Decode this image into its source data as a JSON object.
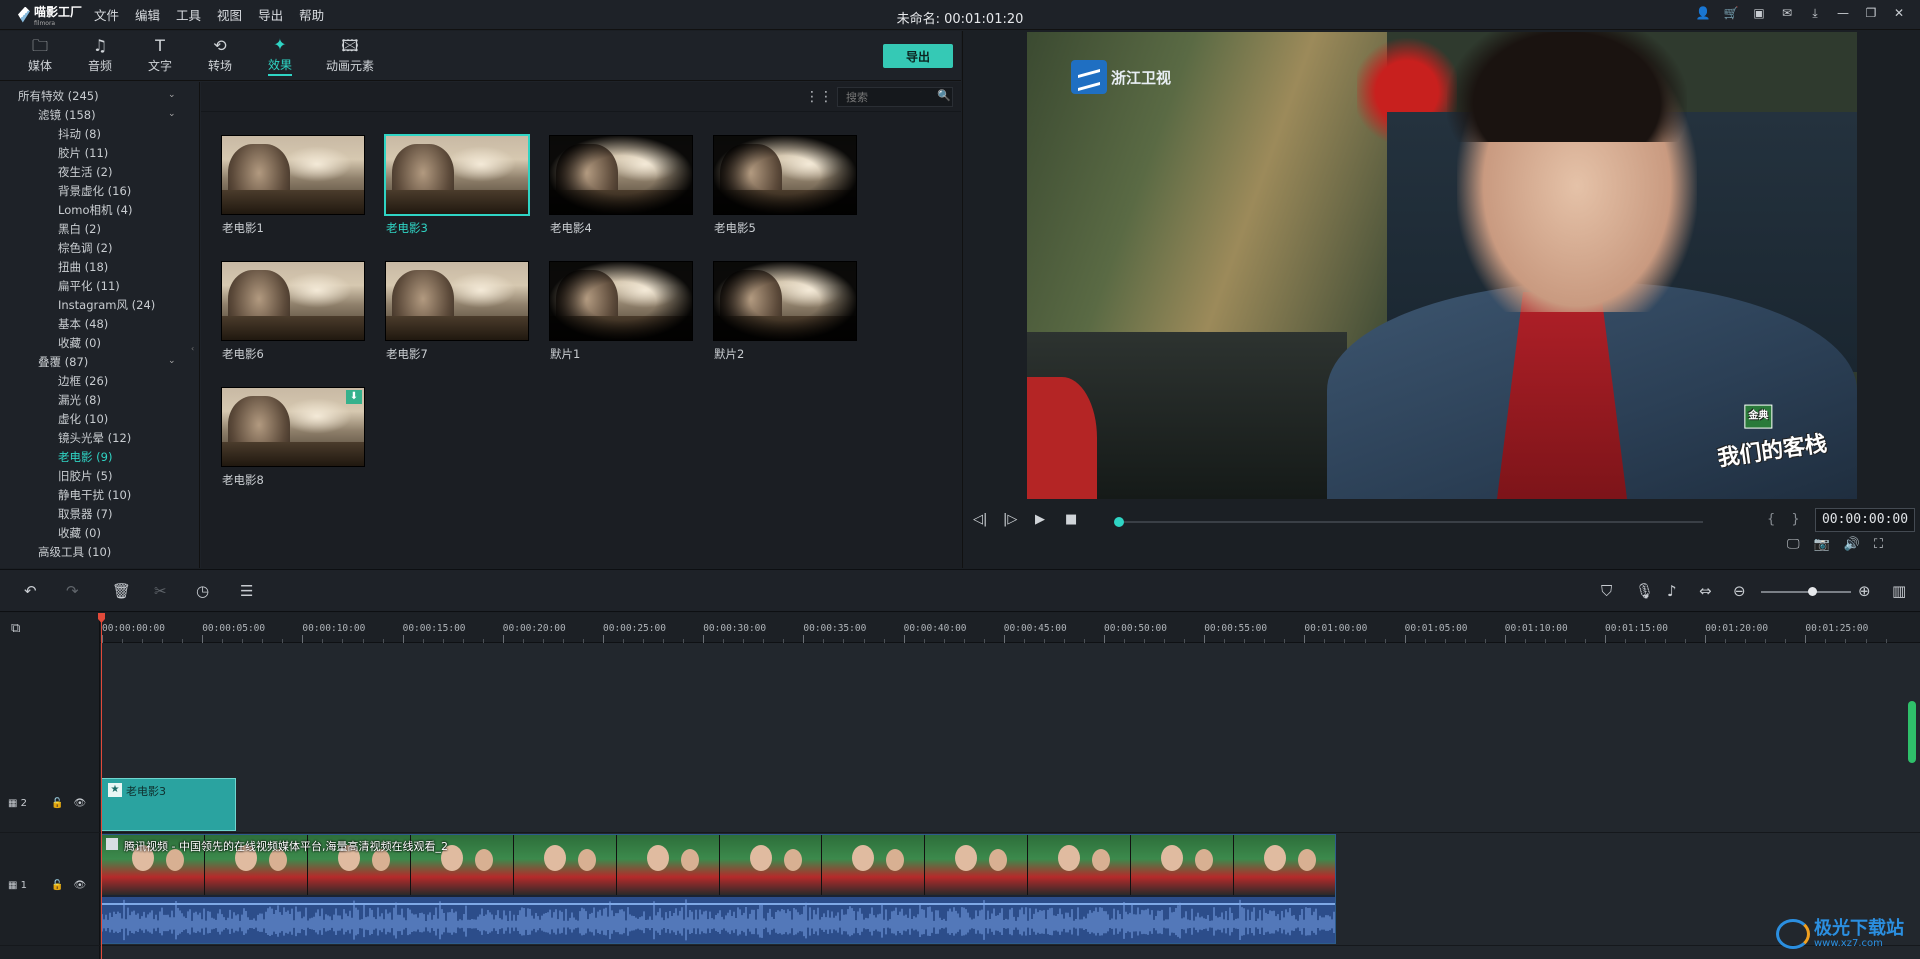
{
  "app": {
    "logo_text": "喵影工厂",
    "logo_sub": "filmora",
    "doc_title": "未命名: 00:01:01:20",
    "menu": [
      "文件",
      "编辑",
      "工具",
      "视图",
      "导出",
      "帮助"
    ]
  },
  "tabs": [
    {
      "label": "媒体",
      "icon": "folder-icon"
    },
    {
      "label": "音频",
      "icon": "music-note-icon"
    },
    {
      "label": "文字",
      "icon": "text-icon"
    },
    {
      "label": "转场",
      "icon": "transition-icon"
    },
    {
      "label": "效果",
      "icon": "effects-icon"
    },
    {
      "label": "动画元素",
      "icon": "image-icon"
    }
  ],
  "export_label": "导出",
  "tree": [
    {
      "label": "所有特效 (245)",
      "level": 0,
      "chevron": true
    },
    {
      "label": "滤镜 (158)",
      "level": 1,
      "chevron": true
    },
    {
      "label": "抖动 (8)",
      "level": 2
    },
    {
      "label": "胶片 (11)",
      "level": 2
    },
    {
      "label": "夜生活 (2)",
      "level": 2
    },
    {
      "label": "背景虚化 (16)",
      "level": 2
    },
    {
      "label": "Lomo相机 (4)",
      "level": 2
    },
    {
      "label": "黑白 (2)",
      "level": 2
    },
    {
      "label": "棕色调 (2)",
      "level": 2
    },
    {
      "label": "扭曲 (18)",
      "level": 2
    },
    {
      "label": "扁平化 (11)",
      "level": 2
    },
    {
      "label": "Instagram风 (24)",
      "level": 2
    },
    {
      "label": "基本 (48)",
      "level": 2
    },
    {
      "label": "收藏 (0)",
      "level": 2
    },
    {
      "label": "叠覆 (87)",
      "level": 1,
      "chevron": true
    },
    {
      "label": "边框 (26)",
      "level": 2
    },
    {
      "label": "漏光 (8)",
      "level": 2
    },
    {
      "label": "虚化 (10)",
      "level": 2
    },
    {
      "label": "镜头光晕 (12)",
      "level": 2
    },
    {
      "label": "老电影 (9)",
      "level": 2,
      "selected": true
    },
    {
      "label": "旧胶片 (5)",
      "level": 2
    },
    {
      "label": "静电干扰 (10)",
      "level": 2
    },
    {
      "label": "取景器 (7)",
      "level": 2
    },
    {
      "label": "收藏 (0)",
      "level": 2
    },
    {
      "label": "高级工具 (10)",
      "level": 1
    }
  ],
  "search": {
    "placeholder": "搜索"
  },
  "effects": [
    {
      "label": "老电影1",
      "vignette": false
    },
    {
      "label": "老电影3",
      "vignette": false,
      "selected": true
    },
    {
      "label": "老电影4",
      "vignette": true
    },
    {
      "label": "老电影5",
      "vignette": true
    },
    {
      "label": "老电影6",
      "vignette": false
    },
    {
      "label": "老电影7",
      "vignette": false
    },
    {
      "label": "默片1",
      "vignette": true
    },
    {
      "label": "默片2",
      "vignette": true
    },
    {
      "label": "老电影8",
      "vignette": false,
      "download": true
    }
  ],
  "preview": {
    "channel_logo": "浙江卫视",
    "show_logo": "我们的客栈",
    "show_badge": "金典",
    "timecode": "00:00:00:00",
    "brackets": "{ }",
    "progress": 0
  },
  "timeline": {
    "ruler": [
      "00:00:00:00",
      "00:00:05:00",
      "00:00:10:00",
      "00:00:15:00",
      "00:00:20:00",
      "00:00:25:00",
      "00:00:30:00",
      "00:00:35:00",
      "00:00:40:00",
      "00:00:45:00",
      "00:00:50:00",
      "00:00:55:00",
      "00:01:00:00",
      "00:01:05:00",
      "00:01:10:00",
      "00:01:15:00",
      "00:01:20:00",
      "00:01:25:00"
    ],
    "tracks": [
      {
        "number": "2"
      },
      {
        "number": "1"
      }
    ],
    "effect_clip": "老电影3",
    "video_clip": "腾讯视频 - 中国领先的在线视频媒体平台,海量高清视频在线观看_2"
  },
  "watermark": {
    "text": "极光下载站",
    "url": "www.xz7.com"
  },
  "colors": {
    "accent": "#2fd4c4",
    "export": "#35c9b5",
    "playhead": "#e24a3a",
    "clip_effect": "#2aa3a0",
    "audio": "#2c4d8a"
  }
}
